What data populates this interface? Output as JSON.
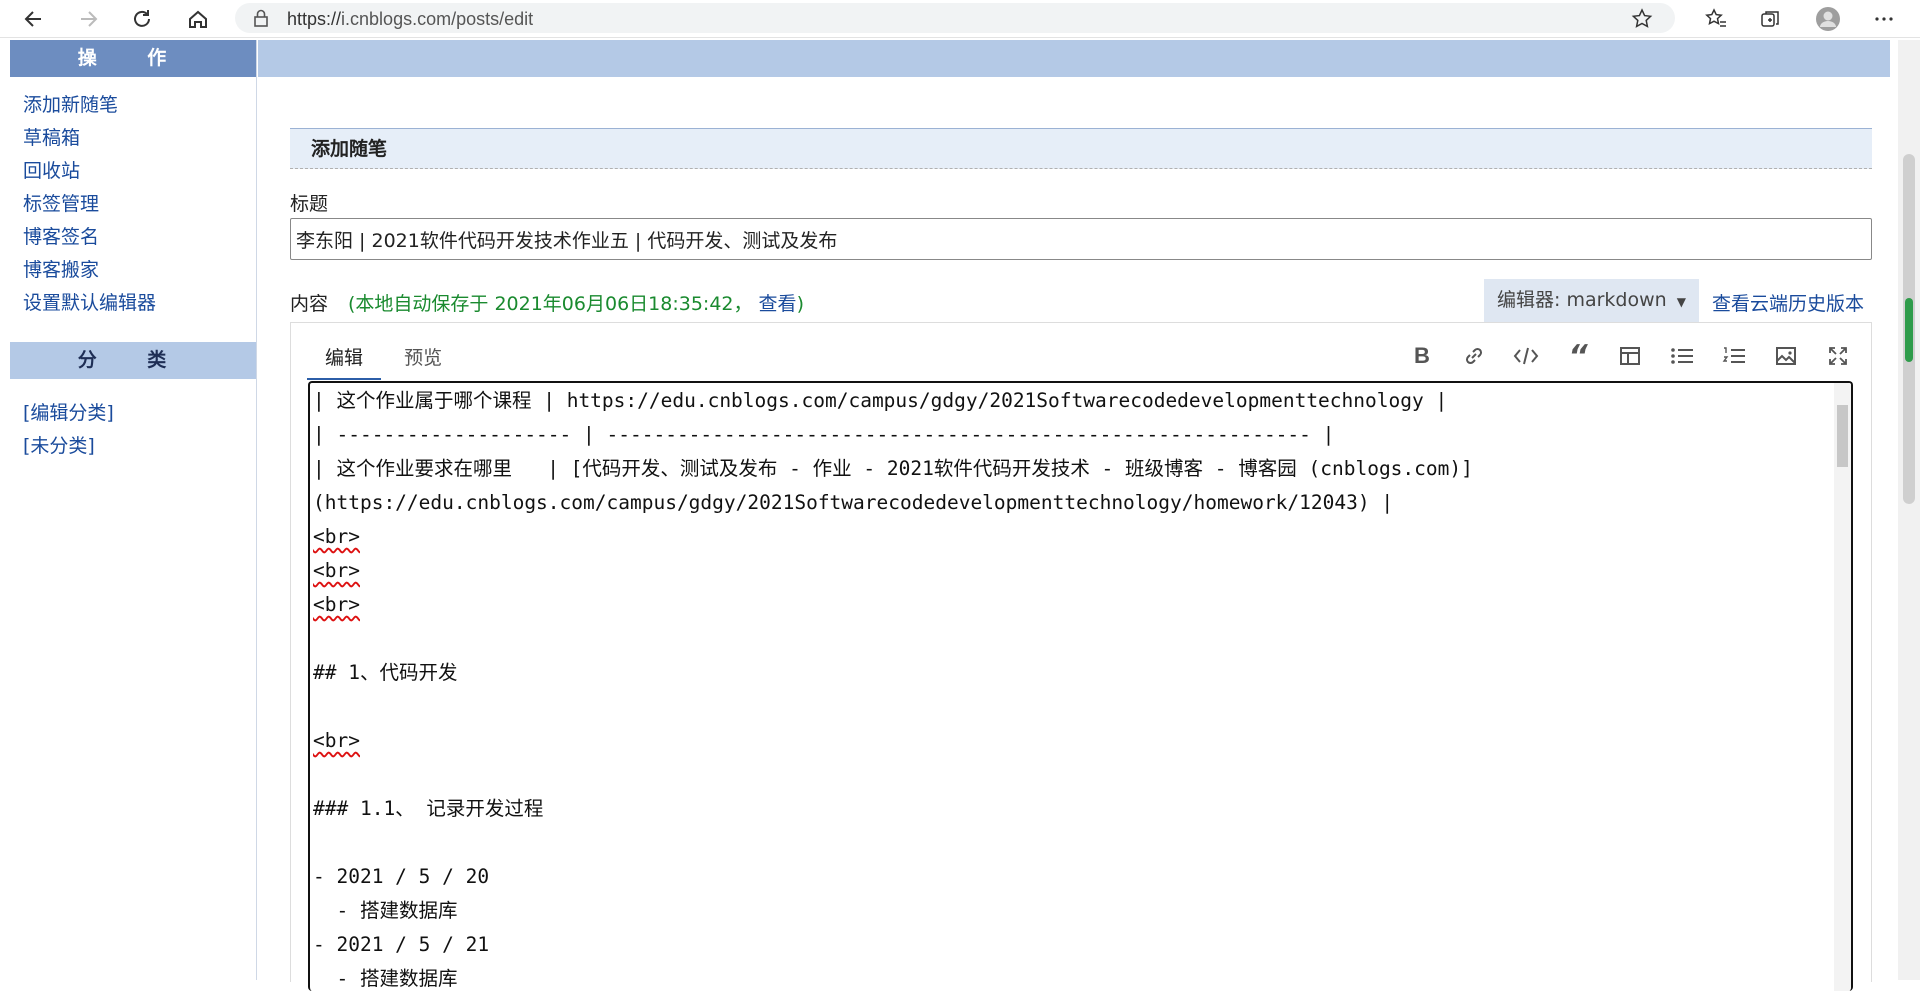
{
  "browser": {
    "url_prefix": "https://",
    "url_host": "i.cnblogs.com",
    "url_path": "/posts/edit"
  },
  "sidebar": {
    "ops_header": "操 作",
    "ops_items": [
      "添加新随笔",
      "草稿箱",
      "回收站",
      "标签管理",
      "博客签名",
      "博客搬家",
      "设置默认编辑器"
    ],
    "cat_header": "分 类",
    "cat_items": [
      "[编辑分类]",
      "[未分类]"
    ]
  },
  "main": {
    "section_title": "添加随笔",
    "title_label": "标题",
    "title_value": "李东阳 | 2021软件代码开发技术作业五 | 代码开发、测试及发布",
    "content_label": "内容",
    "autosave_prefix": "(本地自动保存于 2021年06月06日18:35:42，",
    "autosave_link": "查看",
    "autosave_suffix": ")",
    "editor_select": "编辑器: markdown",
    "history_link": "查看云端历史版本"
  },
  "editor": {
    "tabs": [
      "编辑",
      "预览"
    ],
    "toolbar": [
      "bold-icon",
      "link-icon",
      "code-icon",
      "quote-icon",
      "table-icon",
      "bullet-list-icon",
      "numbered-list-icon",
      "image-icon",
      "fullscreen-icon"
    ],
    "lines": [
      "| 这个作业属于哪个课程 | https://edu.cnblogs.com/campus/gdgy/2021Softwarecodedevelopmenttechnology |",
      "| -------------------- | ------------------------------------------------------------ |",
      "| 这个作业要求在哪里   | [代码开发、测试及发布 - 作业 - 2021软件代码开发技术 - 班级博客 - 博客园 (cnblogs.com)]",
      "(https://edu.cnblogs.com/campus/gdgy/2021Softwarecodedevelopmenttechnology/homework/12043) |",
      "<br>",
      "<br>",
      "<br>",
      "",
      "## 1、代码开发",
      "",
      "<br>",
      "",
      "### 1.1、 记录开发过程",
      "",
      "- 2021 / 5 / 20",
      "  - 搭建数据库",
      "- 2021 / 5 / 21",
      "  - 搭建数据库"
    ]
  }
}
